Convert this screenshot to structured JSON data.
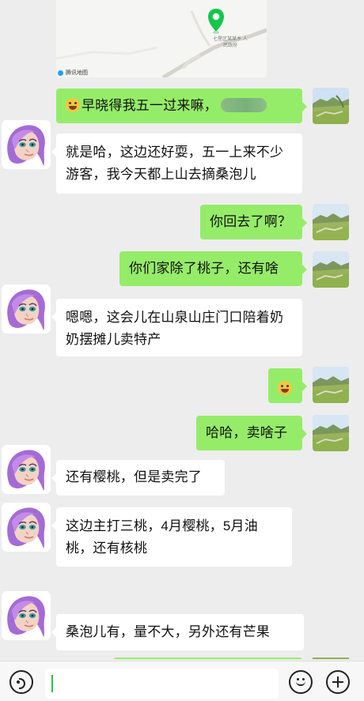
{
  "map": {
    "location_name": "七星区某某乡\n人民政府",
    "provider": "腾讯地图"
  },
  "messages": [
    {
      "sender": "me",
      "emoji": "grinning-face-emoji",
      "text": "早晓得我五一过来嘛，"
    },
    {
      "sender": "other",
      "text": "就是哈，这边还好耍，五一上来不少游客，我今天都上山去摘桑泡儿"
    },
    {
      "sender": "me",
      "text": "你回去了啊？"
    },
    {
      "sender": "me",
      "text": "你们家除了桃子，还有啥"
    },
    {
      "sender": "other",
      "text": "嗯嗯，这会儿在山泉山庄门口陪着奶奶摆摊儿卖特产"
    },
    {
      "sender": "me",
      "emoji": "grinning-face-emoji",
      "text": ""
    },
    {
      "sender": "me",
      "text": "哈哈，卖啥子"
    },
    {
      "sender": "other",
      "text": "还有樱桃，但是卖完了"
    },
    {
      "sender": "other",
      "text": "这边主打三桃，4月樱桃，5月油桃，还有核桃"
    },
    {
      "sender": "other",
      "text": "桑泡儿有，量不大，另外还有芒果"
    }
  ],
  "toolbar": {
    "input_value": "",
    "voice_icon": "voice-icon",
    "emoji_icon": "smile-icon",
    "plus_icon": "plus-icon"
  },
  "colors": {
    "background": "#ededed",
    "incoming_bubble": "#ffffff",
    "outgoing_bubble": "#95ec69",
    "map_pin": "#14c64a",
    "cursor": "#20c744"
  }
}
